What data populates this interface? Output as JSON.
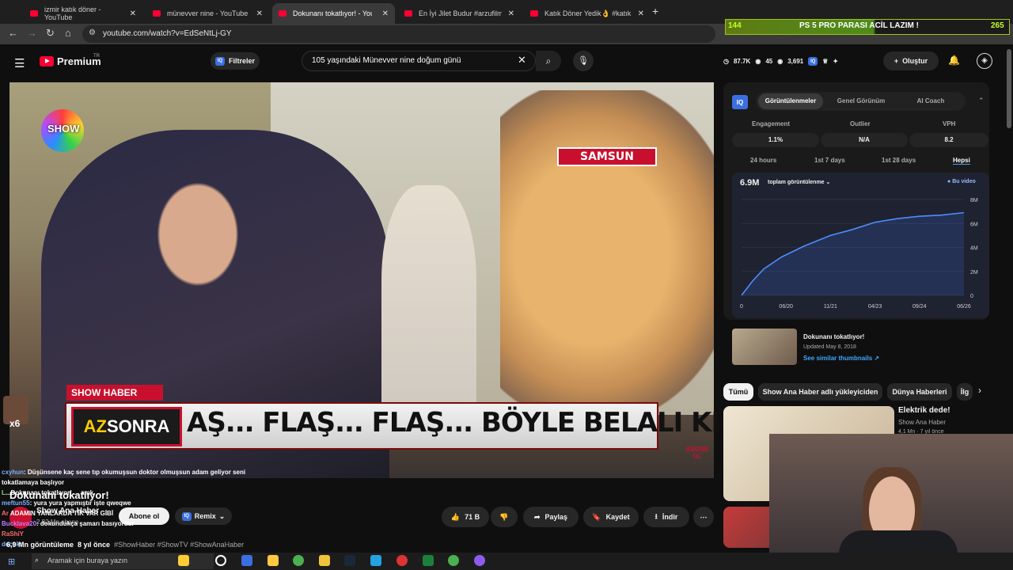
{
  "browser": {
    "tabs": [
      {
        "title": "izmir katık döner - YouTube",
        "active": false
      },
      {
        "title": "münevver nine - YouTube",
        "active": false
      },
      {
        "title": "Dokunanı tokatlıyor! - YouTube",
        "active": true
      },
      {
        "title": "En İyi Jilet Budur #arzufilm #ne",
        "active": false
      },
      {
        "title": "Katık Döner Yedik👌 #katık #dö",
        "active": false
      }
    ],
    "url": "youtube.com/watch?v=EdSeNtLj-GY",
    "overlay": {
      "left": "144",
      "center": "PS 5 PRO PARASI ACİL LAZIM !",
      "right": "265"
    }
  },
  "header": {
    "logo": "Premium",
    "logo_sup": "TR",
    "filters_label": "Filtreler",
    "search_query": "105 yaşındaki Münevver nine doğum günü",
    "stats": {
      "a": "87.7K",
      "b": "45",
      "c": "3,691"
    },
    "create_label": "Oluştur"
  },
  "video": {
    "samsun": "SAMSUN",
    "show_haber": "SHOW HABER",
    "az": "AZ",
    "sonra": "SONRA",
    "ticker": "AŞ... FLAŞ... FLAŞ... BÖYLE BELALI KI",
    "abone_ol": "ABONE OL",
    "show": "SHOW"
  },
  "chat": {
    "count": "x6",
    "lines": [
      {
        "user": "cxyhun",
        "text": ": Düşünsene kaç sene tıp okumuşsun doktor olmuşsun adam geliyor seni"
      },
      {
        "user": "",
        "text": "tokatlamaya başlıyor"
      },
      {
        "user": "L",
        "text": "...Dokunanı tokatlıyor! ... amk"
      },
      {
        "user": "meftun55",
        "text": ": yura yura yapmıştır işte qweqwe"
      },
      {
        "user": "Ar",
        "text": "ADAMIN YANLARDA TİK VAR GİBİ"
      },
      {
        "user": "Bucklava20",
        "text": ": dokundukça şamarı basıyordur"
      },
      {
        "user": "RaShiY",
        "text": ""
      },
      {
        "user": "decok",
        "text": ":"
      }
    ]
  },
  "below": {
    "title": "Dokunanı tokatlıyor!",
    "channel": "Show Ana Haber",
    "subs": "2,92 Mn abone",
    "subscribe": "Abone ol",
    "remix": "Remix",
    "likes": "71 B",
    "share": "Paylaş",
    "save": "Kaydet",
    "download": "İndir",
    "views": "6,9 Mn görüntüleme",
    "age": "8 yıl önce",
    "tags": "#ShowHaber #ShowTV #ShowAnaHaber"
  },
  "panel": {
    "tabs": [
      "Görüntülenmeler",
      "Genel Görünüm",
      "AI Coach"
    ],
    "metrics": [
      {
        "label": "Engagement",
        "value": "1.1%"
      },
      {
        "label": "Outlier",
        "value": "N/A"
      },
      {
        "label": "VPH",
        "value": "8.2"
      }
    ],
    "ranges": [
      "24 hours",
      "1st 7 days",
      "1st 28 days",
      "Hepsi"
    ],
    "big": "6.9M",
    "big_label": "toplam görüntülenme",
    "legend": "Bu video",
    "related": {
      "title": "Dokunanı tokatlıyor!",
      "date": "Updated May 8, 2018",
      "link": "See similar thumbnails"
    }
  },
  "chips": [
    "Tümü",
    "Show Ana Haber adlı yükleyiciden",
    "Dünya Haberleri",
    "İlg"
  ],
  "recommendation": {
    "title": "Elektrik dede!",
    "channel": "Show Ana Haber",
    "meta": "4,1 Mn · 7 yıl önce"
  },
  "taskbar": {
    "search": "Aramak için buraya yazın"
  },
  "chart_data": {
    "type": "line",
    "x": [
      "06/20",
      "11/21",
      "04/23",
      "09/24",
      "06/26"
    ],
    "xticks": [
      "0",
      "06/20",
      "11/21",
      "04/23",
      "09/24",
      "06/26"
    ],
    "yticks": [
      "0",
      "2M",
      "4M",
      "6M",
      "8M"
    ],
    "ylim": [
      0,
      8
    ],
    "series": [
      {
        "name": "Bu video",
        "points": [
          [
            0,
            0
          ],
          [
            0.05,
            1.2
          ],
          [
            0.1,
            2.2
          ],
          [
            0.18,
            3.2
          ],
          [
            0.28,
            4.1
          ],
          [
            0.4,
            5.0
          ],
          [
            0.5,
            5.5
          ],
          [
            0.6,
            6.1
          ],
          [
            0.7,
            6.4
          ],
          [
            0.8,
            6.6
          ],
          [
            0.9,
            6.7
          ],
          [
            1,
            6.9
          ]
        ]
      }
    ]
  }
}
